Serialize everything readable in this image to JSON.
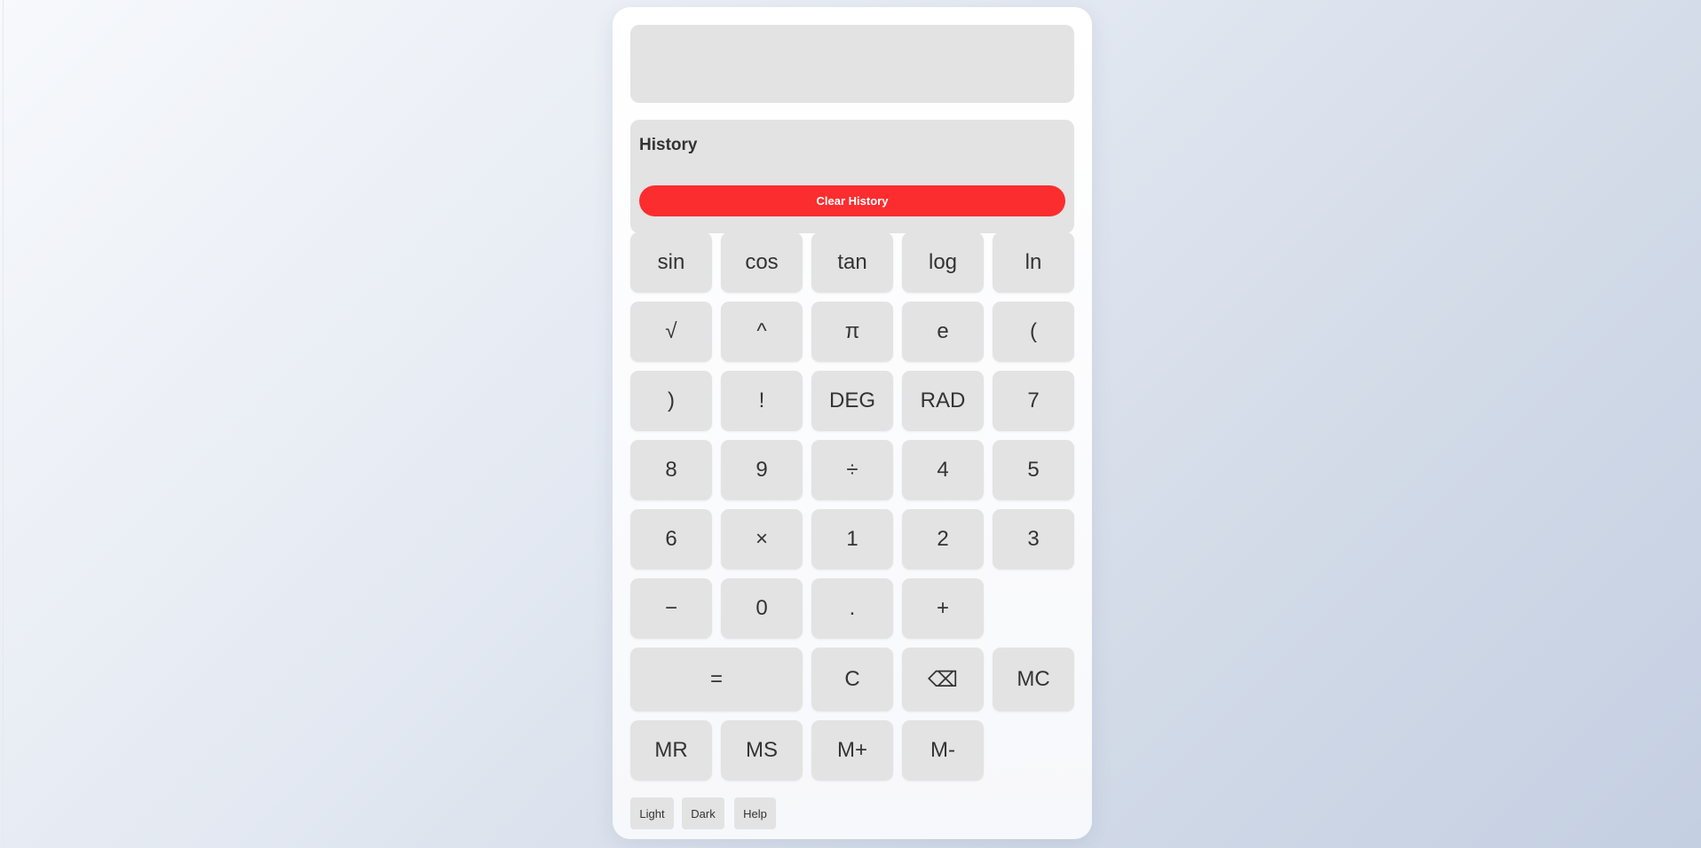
{
  "display": {
    "value": ""
  },
  "history": {
    "title": "History",
    "entries": [],
    "clear_label": "Clear History",
    "clear_color": "#fb2d2f"
  },
  "keypad": {
    "rows": [
      [
        "sin",
        "cos",
        "tan",
        "log",
        "ln"
      ],
      [
        "√",
        "^",
        "π",
        "e",
        "("
      ],
      [
        ")",
        "!",
        "DEG",
        "RAD",
        "7"
      ],
      [
        "8",
        "9",
        "÷",
        "4",
        "5"
      ],
      [
        "6",
        "×",
        "1",
        "2",
        "3"
      ],
      [
        "−",
        "0",
        ".",
        "+"
      ],
      [
        "=",
        "C",
        "⌫",
        "MC"
      ],
      [
        "MR",
        "MS",
        "M+",
        "M-"
      ]
    ]
  },
  "footer": {
    "light_label": "Light",
    "dark_label": "Dark",
    "help_label": "Help"
  },
  "colors": {
    "key_background": "#e3e3e3",
    "text": "#333333",
    "panel": "#ffffff"
  }
}
